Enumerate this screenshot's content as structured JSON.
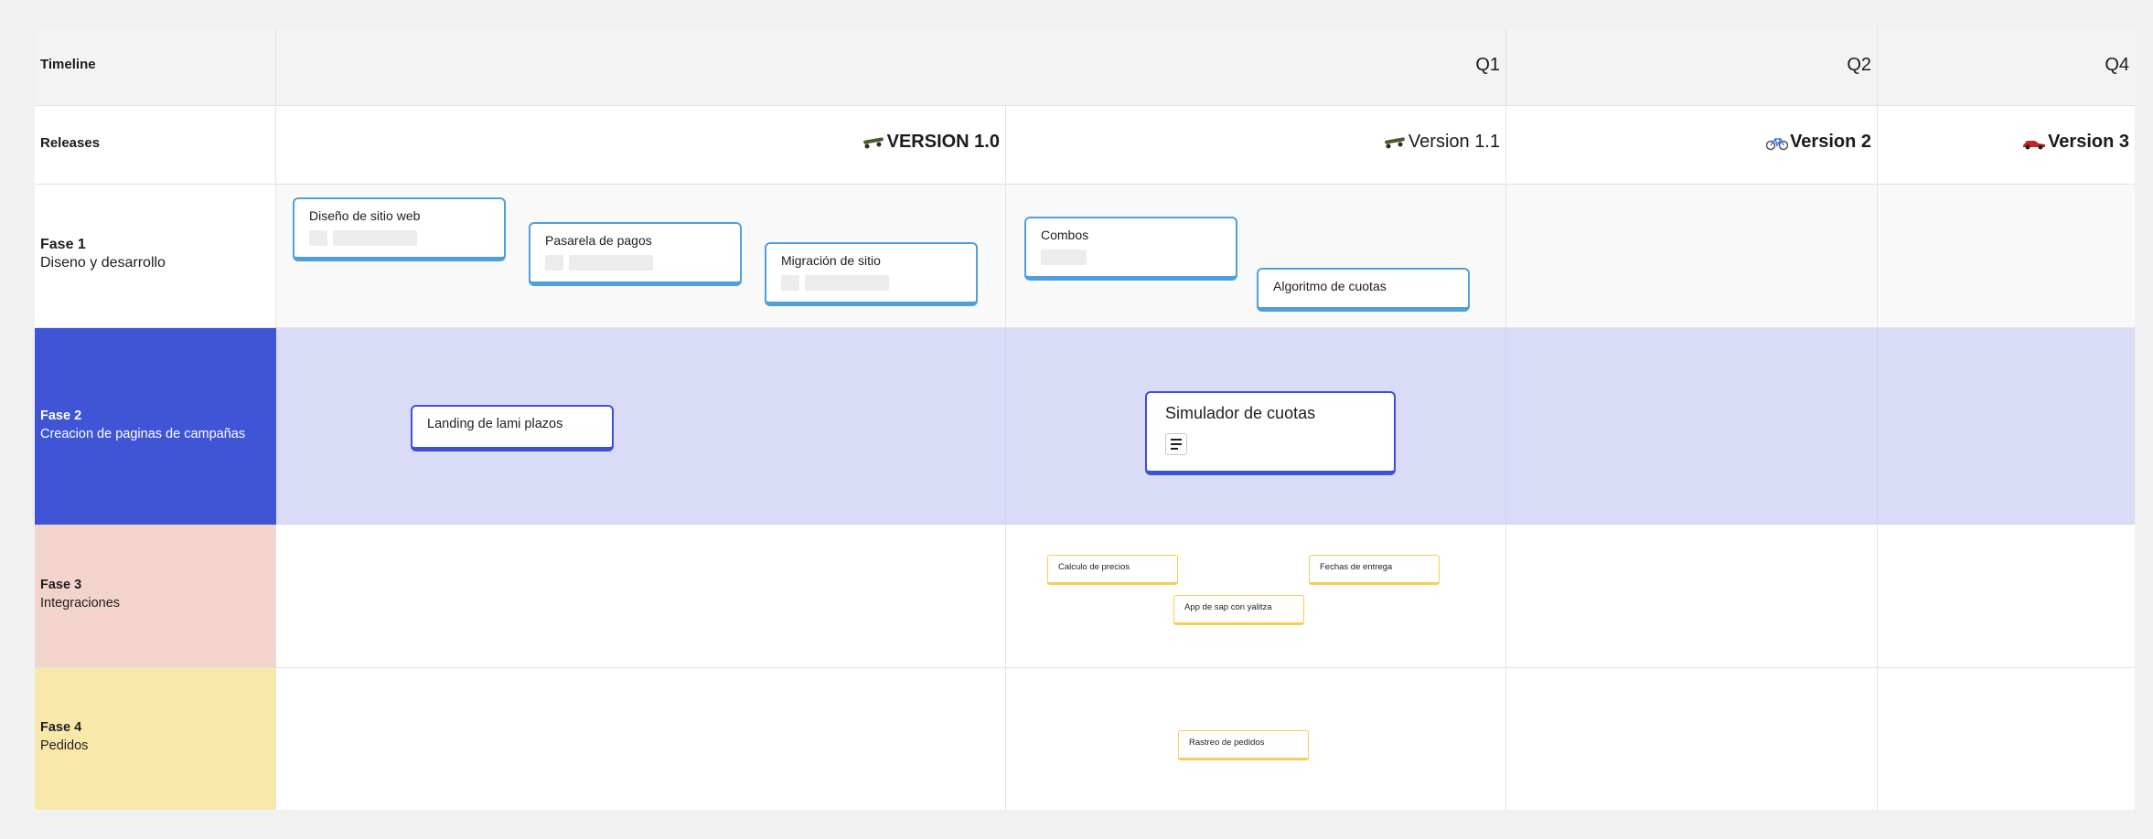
{
  "header": {
    "timeline_label": "Timeline",
    "releases_label": "Releases",
    "quarters": [
      "Q1",
      "Q2",
      "Q4"
    ]
  },
  "releases": [
    {
      "label": "VERSION 1.0",
      "icon": "skateboard-icon"
    },
    {
      "label": "Version 1.1",
      "icon": "skateboard-icon"
    },
    {
      "label": "Version 2",
      "icon": "bicycle-icon"
    },
    {
      "label": "Version 3",
      "icon": "race-car-icon"
    }
  ],
  "phases": [
    {
      "title": "Fase 1",
      "subtitle": "Diseno y desarrollo",
      "color": "#ffffff"
    },
    {
      "title": "Fase 2",
      "subtitle": "Creacion de paginas de campañas",
      "color": "#3f55d5"
    },
    {
      "title": "Fase 3",
      "subtitle": "Integraciones",
      "color": "#f2d4ca"
    },
    {
      "title": "Fase 4",
      "subtitle": "Pedidos",
      "color": "#f8e9ab"
    }
  ],
  "cards": {
    "diseno": "Diseño de sitio web",
    "pasarela": "Pasarela de pagos",
    "migracion": "Migración de sitio",
    "combos": "Combos",
    "algoritmo": "Algoritmo de cuotas",
    "landing": "Landing de lami plazos",
    "simulador": "Simulador de cuotas",
    "calculo": "Calculo de precios",
    "fechas": "Fechas de entrega",
    "app_sap": "App de sap con yalitza",
    "rastreo": "Rastreo de pedidos"
  },
  "colors": {
    "card_blue": "#4f9fdf",
    "card_indigo": "#3d50d6",
    "card_yellow": "#f4cf52",
    "phase2_band": "#dadcf7",
    "phase1_band": "#f9f9f9"
  }
}
